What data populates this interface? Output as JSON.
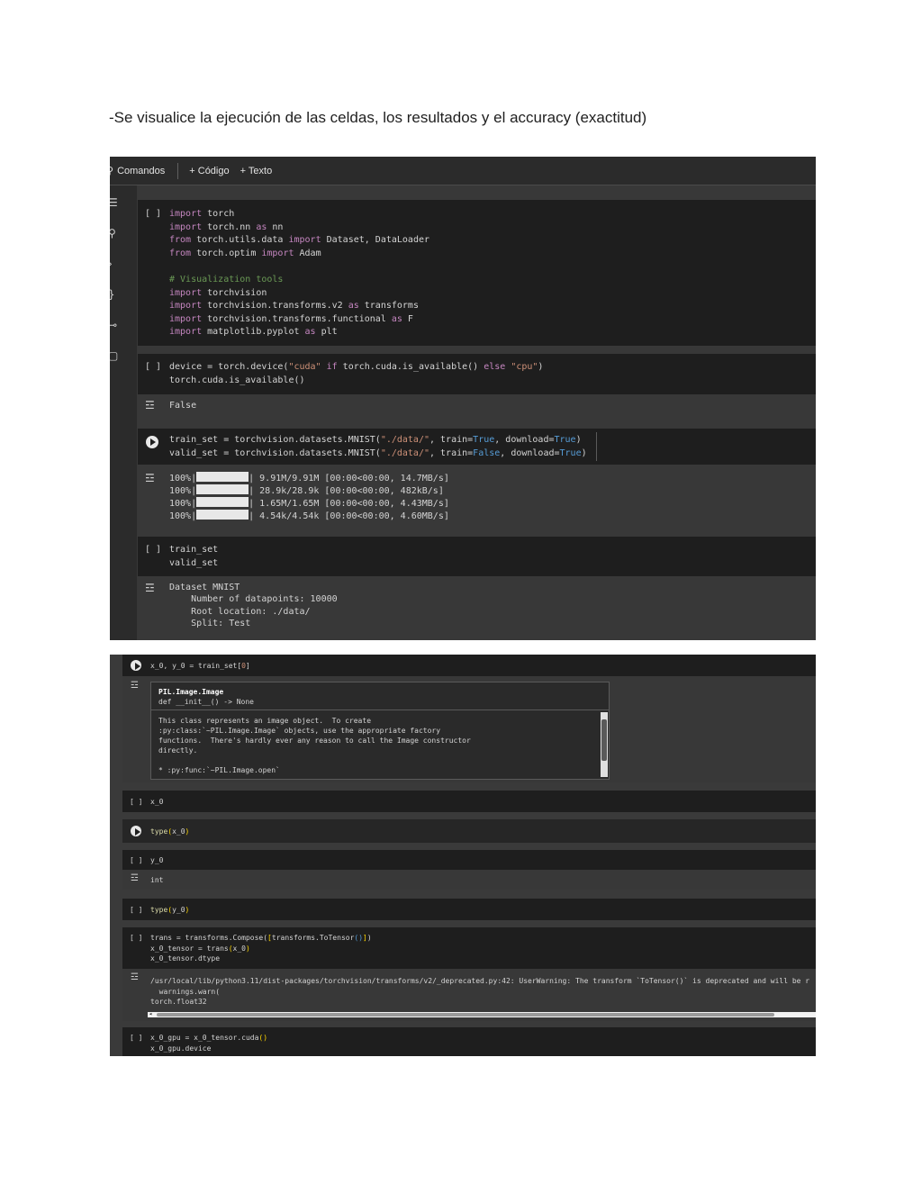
{
  "heading": "-Se visualice la ejecución de las celdas, los resultados y el accuracy (exactitud)",
  "toolbar": {
    "commands": "Comandos",
    "add_code": "+ Código",
    "add_text": "+ Texto"
  },
  "cell_bracket": "[ ]",
  "cells1": {
    "imports": {
      "l1": [
        "import",
        " torch"
      ],
      "l2": [
        "import",
        " torch.nn ",
        "as",
        " nn"
      ],
      "l3": [
        "from",
        " torch.utils.data ",
        "import",
        " Dataset, DataLoader"
      ],
      "l4": [
        "from",
        " torch.optim ",
        "import",
        " Adam"
      ],
      "l5": "# Visualization tools",
      "l6": [
        "import",
        " torchvision"
      ],
      "l7": [
        "import",
        " torchvision.transforms.v2 ",
        "as",
        " transforms"
      ],
      "l8": [
        "import",
        " torchvision.transforms.functional ",
        "as",
        " F"
      ],
      "l9": [
        "import",
        " matplotlib.pyplot ",
        "as",
        " plt"
      ]
    },
    "device": {
      "l1a": "device = torch.device(",
      "l1b": "\"cuda\"",
      "l1c": " if ",
      "l1d": "torch.cuda.is_available()",
      "l1e": " else ",
      "l1f": "\"cpu\"",
      "l1g": ")",
      "l2": "torch.cuda.is_available()",
      "output": "False"
    },
    "datasets": {
      "l1a": "train_set = torchvision.datasets.MNIST(",
      "l1b": "\"./data/\"",
      "l1c": ", train=",
      "l1d": "True",
      "l1e": ", download=",
      "l1f": "True",
      "l1g": ")",
      "l2a": "valid_set = torchvision.datasets.MNIST(",
      "l2b": "\"./data/\"",
      "l2c": ", train=",
      "l2d": "False",
      "l2e": ", download=",
      "l2f": "True",
      "l2g": ")",
      "progress": [
        {
          "pct": "100%|",
          "rest": "| 9.91M/9.91M [00:00<00:00, 14.7MB/s]"
        },
        {
          "pct": "100%|",
          "rest": "| 28.9k/28.9k [00:00<00:00, 482kB/s]"
        },
        {
          "pct": "100%|",
          "rest": "| 1.65M/1.65M [00:00<00:00, 4.43MB/s]"
        },
        {
          "pct": "100%|",
          "rest": "| 4.54k/4.54k [00:00<00:00, 4.60MB/s]"
        }
      ]
    },
    "show_sets": {
      "l1": "train_set",
      "l2": "valid_set",
      "o1": "Dataset MNIST",
      "o2": "    Number of datapoints: 10000",
      "o3": "    Root location: ./data/",
      "o4": "    Split: Test"
    }
  },
  "cells2": {
    "first": {
      "code_a": "x_0, y_0 = train_set[",
      "code_b": "0",
      "code_c": "]"
    },
    "tooltip": {
      "title": "PIL.Image.Image",
      "sig": "def __init__() -> None",
      "d1": "This class represents an image object.  To create",
      "d2": ":py:class:`~PIL.Image.Image` objects, use the appropriate factory",
      "d3": "functions.  There's hardly ever any reason to call the Image constructor",
      "d4": "directly.",
      "d5": "* :py:func:`~PIL.Image.open`"
    },
    "x0": "x_0",
    "type_x0": {
      "fn": "type",
      "arg_open": "(",
      "arg": "x_0",
      "arg_close": ")"
    },
    "y0": "y_0",
    "y0_out": "int",
    "type_y0": {
      "fn": "type",
      "arg_open": "(",
      "arg": "y_0",
      "arg_close": ")"
    },
    "trans": {
      "l1a": "trans = transforms.Compose(",
      "l1b": "[",
      "l1c": "transforms.ToTensor",
      "l1d": "()",
      "l1e": "]",
      "l1f": ")",
      "l2a": "x_0_tensor = trans",
      "l2b": "(",
      "l2c": "x_0",
      "l2d": ")",
      "l3": "x_0_tensor.dtype",
      "o1": "/usr/local/lib/python3.11/dist-packages/torchvision/transforms/v2/_deprecated.py:42: UserWarning: The transform `ToTensor()` is deprecated and will be r",
      "o2": "  warnings.warn(",
      "o3": "torch.float32"
    },
    "gpu": {
      "l1a": "x_0_gpu = x_0_tensor.cuda",
      "l1b": "()",
      "l2": "x_0_gpu.device"
    }
  },
  "icons": {
    "output_icon": "output-toggle-icon",
    "run_icon": "play-circle-icon",
    "search_icon": "search-icon",
    "rail": [
      "menu-icon",
      "search-icon",
      "chevron-right-icon",
      "variables-icon",
      "secrets-icon",
      "files-icon"
    ]
  },
  "colors": {
    "keyword": "#c586c0",
    "string": "#ce9178",
    "boolean": "#569cd6",
    "comment": "#6a9955",
    "function": "#dcdcaa",
    "bracket": "#ffd700",
    "cell_bg": "#1e1e1e"
  }
}
